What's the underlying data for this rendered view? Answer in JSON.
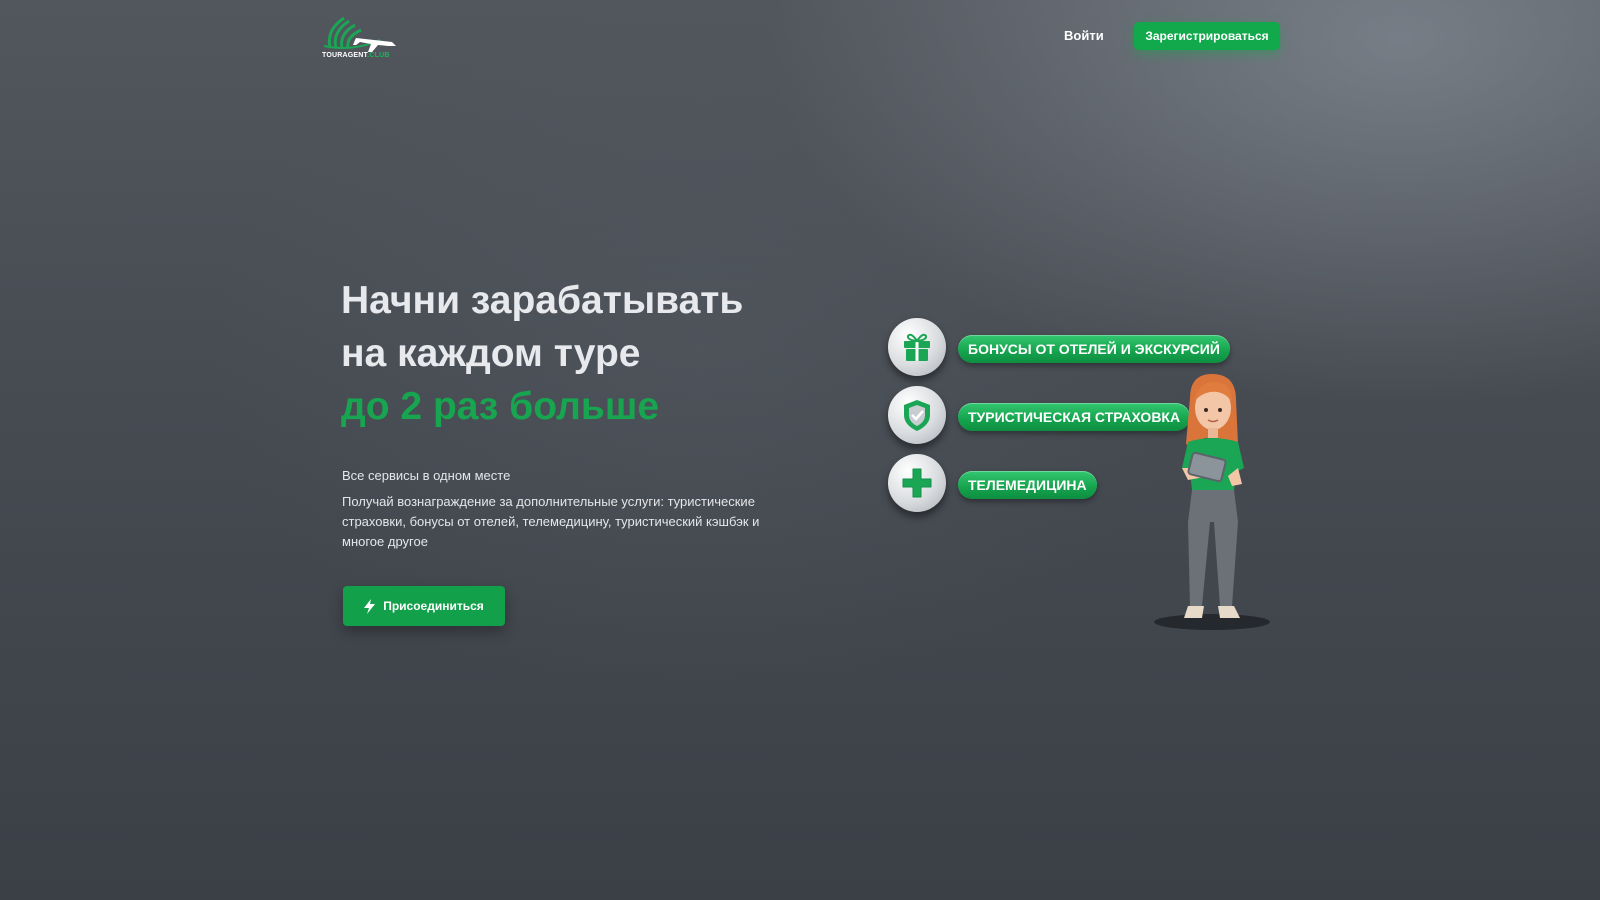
{
  "header": {
    "logo": {
      "name": "TOURAGENT",
      "domain": ".CLUB",
      "icon": "airplane-globe-logo"
    },
    "login_label": "Войти",
    "register_label": "Зарегистрироваться"
  },
  "hero": {
    "title_line1": "Начни зарабатывать",
    "title_line2": "на каждом туре",
    "title_accent": "до 2 раз больше",
    "lead": "Все сервисы в одном месте",
    "description": "Получай вознаграждение за дополнительные услуги: туристические страховки, бонусы от отелей, телемедицину, туристический кэшбэк и многое другое",
    "join_label": "Присоединиться",
    "join_icon": "lightning-icon"
  },
  "features": [
    {
      "label": "БОНУСЫ ОТ ОТЕЛЕЙ И ЭКСКУРСИЙ",
      "icon": "gift-icon"
    },
    {
      "label": "ТУРИСТИЧЕСКАЯ СТРАХОВКА",
      "icon": "shield-check-icon"
    },
    {
      "label": "ТЕЛЕМЕДИЦИНА",
      "icon": "medical-cross-icon"
    }
  ],
  "colors": {
    "accent": "#12a94c",
    "background_top": "#52575e",
    "background_bottom": "#3b3f46",
    "text": "#e7e9ec"
  }
}
